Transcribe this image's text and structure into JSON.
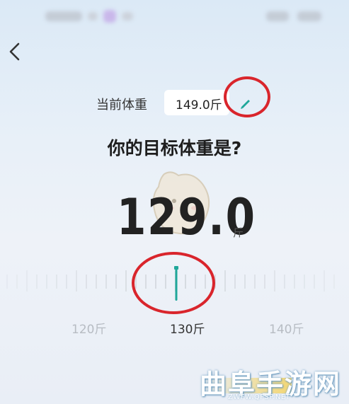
{
  "current_weight": {
    "label": "当前体重",
    "value": "149.0斤"
  },
  "question": "你的目标体重是?",
  "target": {
    "value": "129.0",
    "unit": "斤"
  },
  "ruler": {
    "labels": [
      "120斤",
      "130斤",
      "140斤"
    ],
    "selected_label_color": "#333333",
    "other_label_color": "#b7bcc3"
  },
  "accent_color": "#1fa79a",
  "highlight_color": "#d9252c",
  "watermark": {
    "title": "曲阜手游网",
    "url": "ZWFW.QFSP.NET"
  }
}
